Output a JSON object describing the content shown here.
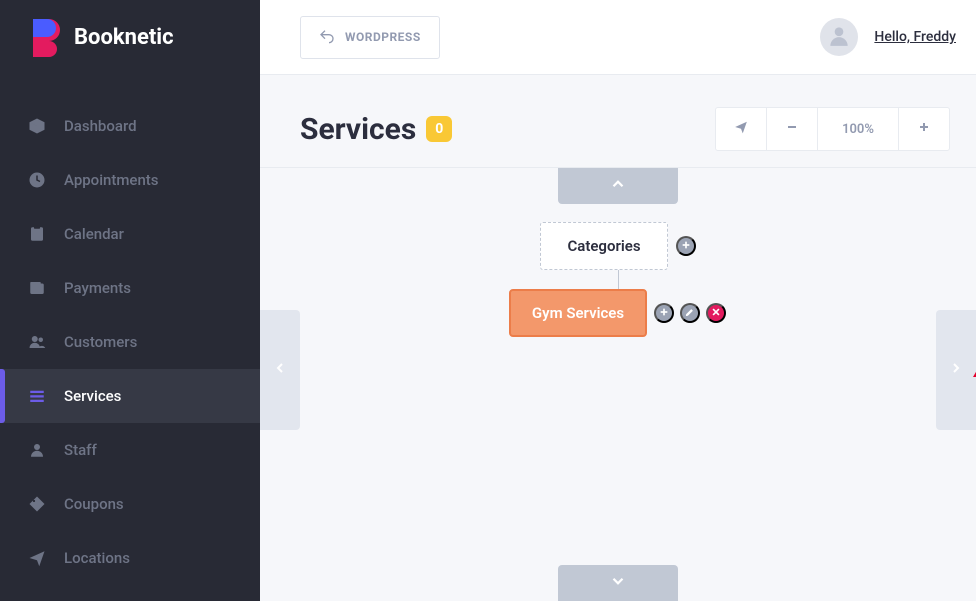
{
  "brand": {
    "name": "Booknetic"
  },
  "topbar": {
    "back_label": "WORDPRESS",
    "greeting": "Hello, Freddy"
  },
  "nav": {
    "items": [
      {
        "label": "Dashboard",
        "icon": "box"
      },
      {
        "label": "Appointments",
        "icon": "clock"
      },
      {
        "label": "Calendar",
        "icon": "clipboard"
      },
      {
        "label": "Payments",
        "icon": "wallet"
      },
      {
        "label": "Customers",
        "icon": "users"
      },
      {
        "label": "Services",
        "icon": "bars",
        "active": true
      },
      {
        "label": "Staff",
        "icon": "user"
      },
      {
        "label": "Coupons",
        "icon": "tag"
      },
      {
        "label": "Locations",
        "icon": "plane"
      }
    ]
  },
  "page": {
    "title": "Services",
    "count": "0",
    "zoom": "100%"
  },
  "tree": {
    "root_label": "Categories",
    "child_label": "Gym Services"
  }
}
